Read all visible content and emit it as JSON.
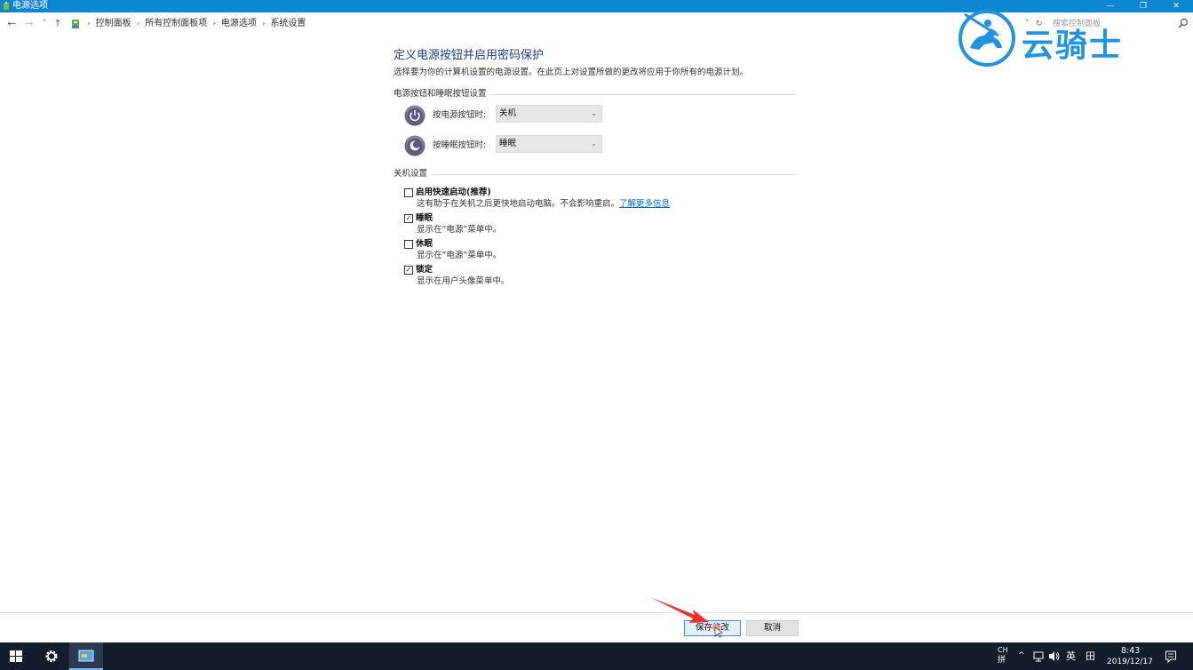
{
  "window": {
    "title": "电源选项",
    "min_glyph": "—",
    "restore_glyph": "❐",
    "close_glyph": "✕"
  },
  "nav": {
    "back": "←",
    "forward": "→",
    "recent": "˅",
    "up": "↑"
  },
  "breadcrumbs": [
    "控制面板",
    "所有控制面板项",
    "电源选项",
    "系统设置"
  ],
  "breadcrumb_sep": "›",
  "address": {
    "dropdown": "˅",
    "refresh": "↻"
  },
  "search": {
    "placeholder": "搜索控制面板"
  },
  "watermark": {
    "text": "云骑士"
  },
  "page": {
    "title": "定义电源按钮并启用密码保护",
    "description": "选择要为你的计算机设置的电源设置。在此页上对设置所做的更改将应用于你所有的电源计划。",
    "buttons_section": "电源按钮和睡眠按钮设置",
    "power_label": "按电源按钮时:",
    "power_value": "关机",
    "sleep_label": "按睡眠按钮时:",
    "sleep_value": "睡眠",
    "shutdown_section": "关机设置",
    "caret": "⌄"
  },
  "options": [
    {
      "label": "启用快速启动(推荐)",
      "desc": "这有助于在关机之后更快地启动电脑。不会影响重启。",
      "link": "了解更多信息",
      "checked": false
    },
    {
      "label": "睡眠",
      "desc": "显示在“电源”菜单中。",
      "link": "",
      "checked": true
    },
    {
      "label": "休眠",
      "desc": "显示在“电源”菜单中。",
      "link": "",
      "checked": false
    },
    {
      "label": "锁定",
      "desc": "显示在用户头像菜单中。",
      "link": "",
      "checked": true
    }
  ],
  "check_mark": "✓",
  "actions": {
    "save": "保存修改",
    "cancel": "取消"
  },
  "taskbar": {
    "ime_top": "CH",
    "ime_bottom": "拼",
    "tray_chevron": "^",
    "lang": "英",
    "ime_grid": "田",
    "time": "8:43",
    "date": "2019/12/17"
  },
  "colors": {
    "titlebar": "#0c86d0",
    "title_text": "#1b3d8b",
    "link": "#0066cc",
    "taskbar": "#131d2b",
    "watermark": "#2193e0",
    "arrow": "#e8322b"
  }
}
